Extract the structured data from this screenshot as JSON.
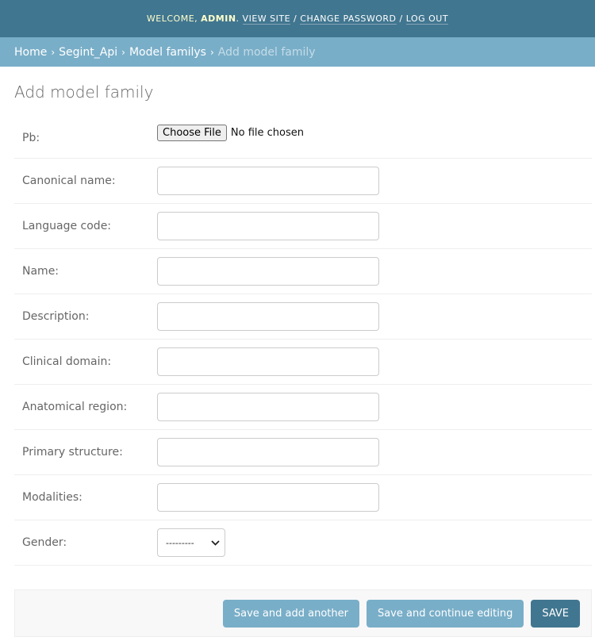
{
  "header": {
    "welcome": "Welcome,",
    "user": "admin",
    "view_site": "View site",
    "change_password": "Change password",
    "log_out": "Log out",
    "separator": "/"
  },
  "breadcrumbs": {
    "home": "Home",
    "app": "Segint_Api",
    "model": "Model familys",
    "current": "Add model family",
    "separator": "›"
  },
  "page": {
    "title": "Add model family"
  },
  "form": {
    "pb": {
      "label": "Pb:",
      "button": "Choose File",
      "status": "No file chosen"
    },
    "canonical_name": {
      "label": "Canonical name:",
      "value": ""
    },
    "language_code": {
      "label": "Language code:",
      "value": ""
    },
    "name": {
      "label": "Name:",
      "value": ""
    },
    "description": {
      "label": "Description:",
      "value": ""
    },
    "clinical_domain": {
      "label": "Clinical domain:",
      "value": ""
    },
    "anatomical_region": {
      "label": "Anatomical region:",
      "value": ""
    },
    "primary_structure": {
      "label": "Primary structure:",
      "value": ""
    },
    "modalities": {
      "label": "Modalities:",
      "value": ""
    },
    "gender": {
      "label": "Gender:",
      "selected": "---------"
    }
  },
  "actions": {
    "save_add_another": "Save and add another",
    "save_continue": "Save and continue editing",
    "save": "Save"
  },
  "colors": {
    "header_bg": "#417690",
    "breadcrumb_bg": "#79aec8",
    "button_secondary": "#79aec8",
    "button_primary": "#417690"
  }
}
